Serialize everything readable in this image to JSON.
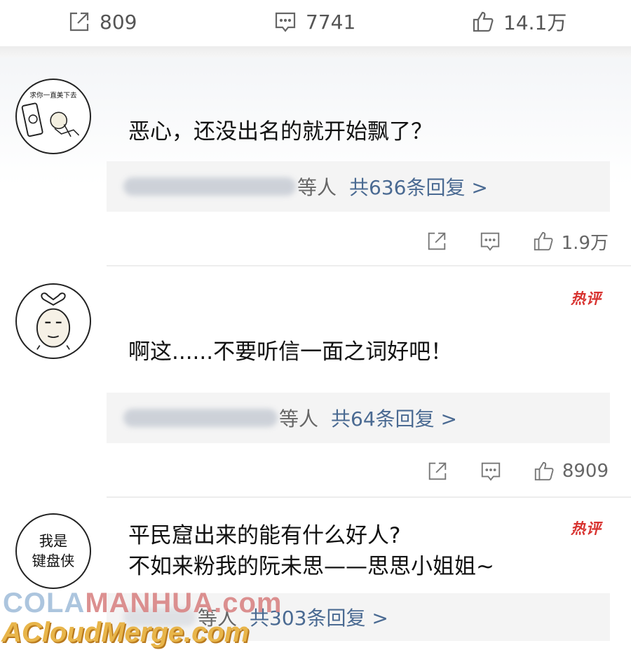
{
  "top_bar": {
    "share_count": "809",
    "comment_count": "7741",
    "like_count": "14.1万"
  },
  "comments": [
    {
      "avatar_caption": "求你一直美下去",
      "text": "恶心，还没出名的就开始飘了？",
      "hot_badge": "",
      "reply_who": "等人",
      "reply_link": "共636条回复 >",
      "like_count": "1.9万"
    },
    {
      "avatar_caption": "",
      "text": "啊这......不要听信一面之词好吧！",
      "hot_badge": "热评",
      "reply_who": "等人",
      "reply_link": "共64条回复 >",
      "like_count": "8909"
    },
    {
      "avatar_caption": "我是\n键盘侠",
      "text": "平民窟出来的能有什么好人?\n不如来粉我的阮未思——思思小姐姐~",
      "hot_badge": "热评",
      "reply_who": "等人",
      "reply_link": "共303条回复 >",
      "like_count": ""
    }
  ],
  "watermark": {
    "line1_a": "COLA",
    "line1_b": "MANHUA.com",
    "line2": "ACloudMerge.com"
  },
  "icons": [
    "share-icon",
    "comment-icon",
    "like-icon"
  ]
}
